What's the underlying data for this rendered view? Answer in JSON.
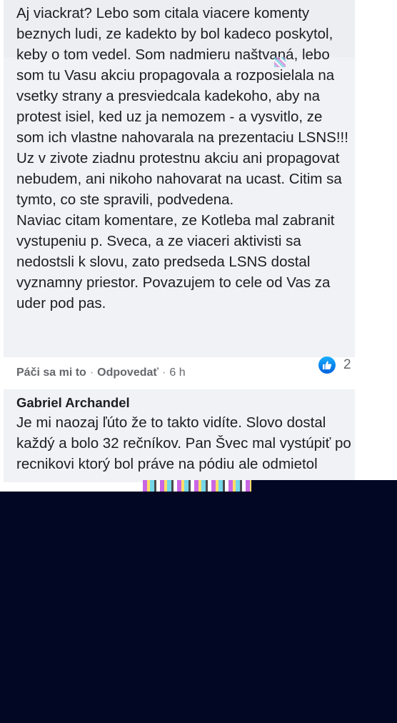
{
  "comment": {
    "text": "Aj viackrat? Lebo som citala viacere komenty beznych ludi, ze kadekto by bol kadeco poskytol, keby o tom vedel. Som nadmieru naštvaná, lebo som tu Vasu akciu propagovala a rozposielala na vsetky strany a presviedcala kadekoho, aby na protest isiel, ked uz ja nemozem - a vysvitlo, ze som ich vlastne nahovarala na prezentaciu LSNS!!!\nUz v zivote ziadnu protestnu akciu ani propagovat nebudem, ani nikoho nahovarat na ucast. Citim sa tymto, co ste spravili, podvedena.\nNaviac citam komentare, ze Kotleba mal zabranit vystupeniu p. Sveca, a ze viaceri aktivisti sa nedostsli k slovu, zato predseda LSNS dostal vyznamny priestor. Povazujem to cele od Vas za uder pod pas.",
    "like_label": "Páči sa mi to",
    "reply_label": "Odpovedať",
    "time": "6 h",
    "reaction_icon": "thumbs-up-icon",
    "reaction_count": "2"
  },
  "reply": {
    "author": "Gabriel Archandel",
    "text": "Je mi naozaj ľúto že to takto vidíte. Slovo dostal každý a bolo 32 rečníkov. Pan Švec mal vystúpiť po recnikovi ktorý bol práve na pódiu ale odmietol"
  },
  "colors": {
    "bubble": "#f0f2f5",
    "meta_text": "#65676b",
    "like_blue": "#1877f2",
    "overlay": "#020823"
  }
}
